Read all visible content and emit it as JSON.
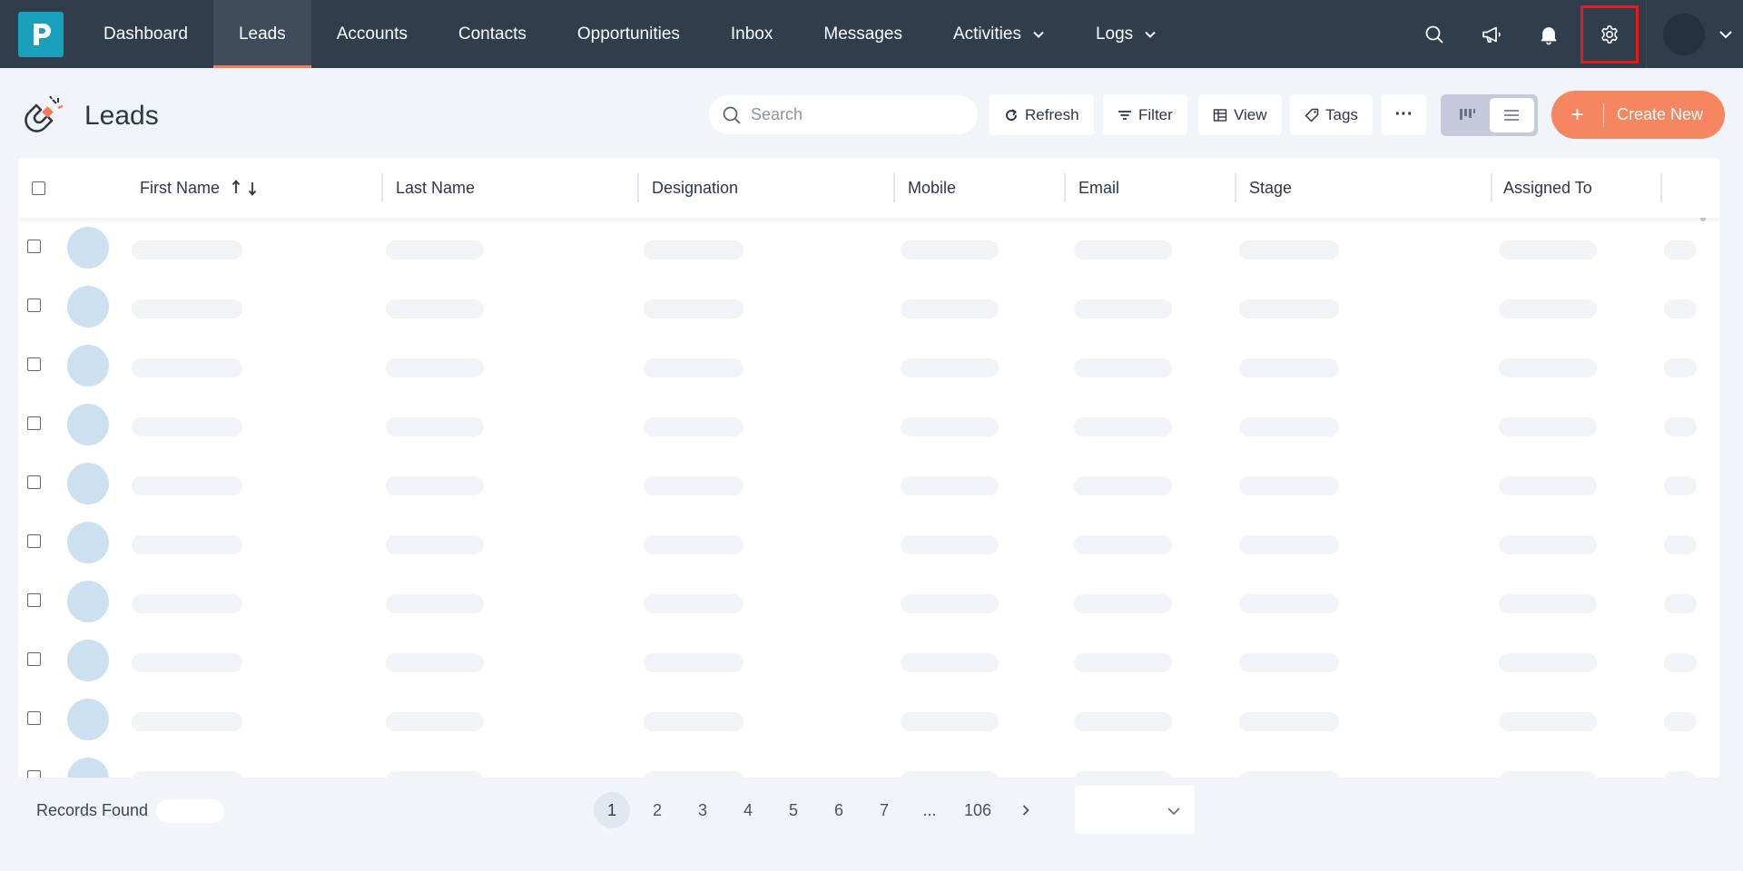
{
  "nav": {
    "items": [
      {
        "label": "Dashboard"
      },
      {
        "label": "Leads"
      },
      {
        "label": "Accounts"
      },
      {
        "label": "Contacts"
      },
      {
        "label": "Opportunities"
      },
      {
        "label": "Inbox"
      },
      {
        "label": "Messages"
      },
      {
        "label": "Activities"
      },
      {
        "label": "Logs"
      }
    ],
    "active": "Leads",
    "icons": [
      "search-icon",
      "megaphone-icon",
      "bell-icon",
      "gear-icon",
      "user-avatar",
      "chevron-down-icon"
    ]
  },
  "page": {
    "title": "Leads",
    "icon": "magnet-icon"
  },
  "toolbar": {
    "search_placeholder": "Search",
    "refresh_label": "Refresh",
    "filter_label": "Filter",
    "view_label": "View",
    "tags_label": "Tags",
    "more_label": "···",
    "create_plus": "+",
    "create_label": "Create New"
  },
  "table": {
    "columns": [
      "First Name",
      "Last Name",
      "Designation",
      "Mobile",
      "Email",
      "Stage",
      "Assigned To"
    ]
  },
  "footer": {
    "records_label": "Records Found",
    "pages": [
      "1",
      "2",
      "3",
      "4",
      "5",
      "6",
      "7",
      "...",
      "106"
    ],
    "current_page": "1"
  },
  "colors": {
    "nav_bg": "#2f3d4d",
    "accent": "#f47a5a",
    "create_button": "#f68660",
    "logo": "#1a9fbc",
    "highlight_box": "#e01e1e"
  }
}
